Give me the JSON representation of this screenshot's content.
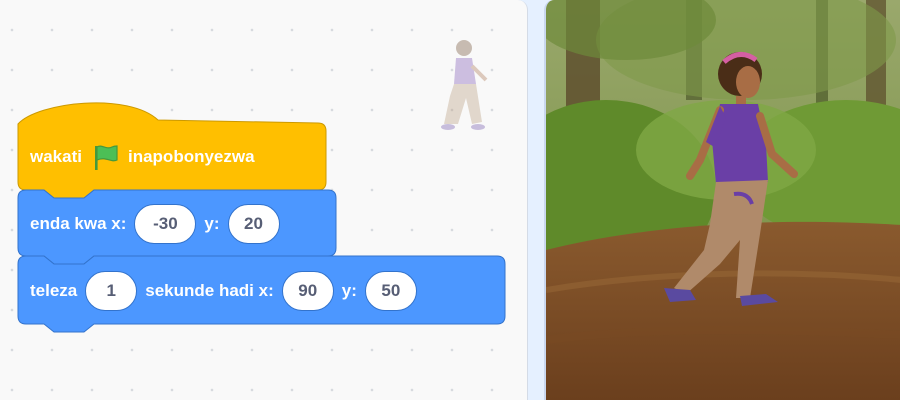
{
  "event_block": {
    "text_before": "wakati",
    "flag_icon": "green-flag-icon",
    "text_after": "inapobonyezwa",
    "color": "#ffbf00"
  },
  "goto_block": {
    "label": "enda kwa x:",
    "x_value": "-30",
    "y_label": "y:",
    "y_value": "20",
    "color": "#4c97ff"
  },
  "glide_block": {
    "label": "teleza",
    "seconds_value": "1",
    "mid_label": "sekunde hadi x:",
    "x_value": "90",
    "y_label": "y:",
    "y_value": "50",
    "color": "#4c97ff"
  },
  "sprite_thumbnail": "sprite-ghost-icon",
  "stage": {
    "backdrop": "forest-path",
    "sprite": "walking-girl"
  }
}
